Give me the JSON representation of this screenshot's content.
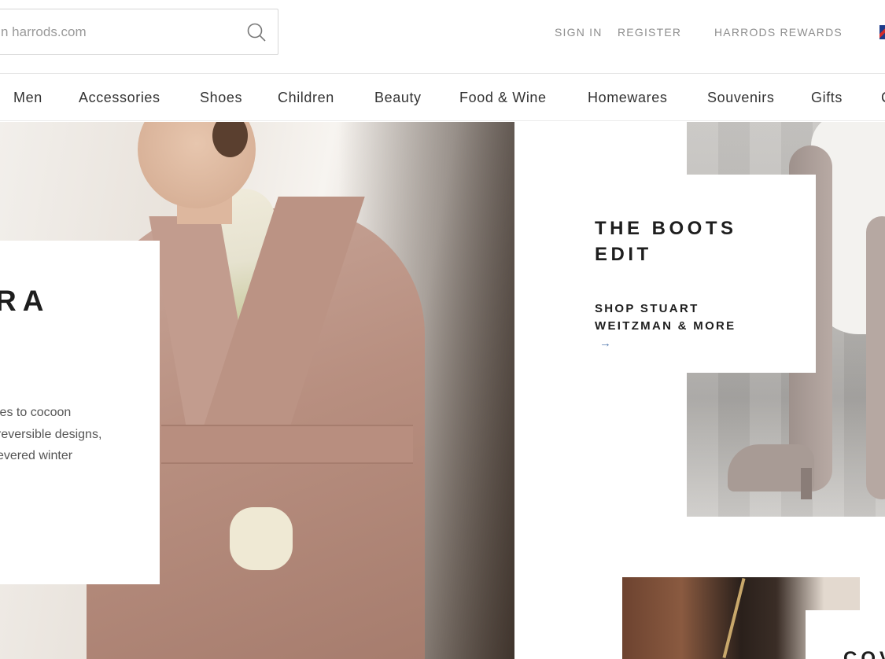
{
  "search": {
    "placeholder": "n harrods.com"
  },
  "header": {
    "sign_in": "SIGN IN",
    "register": "REGISTER",
    "rewards": "HARRODS REWARDS"
  },
  "nav": {
    "items": [
      "Men",
      "Accessories",
      "Shoes",
      "Children",
      "Beauty",
      "Food & Wine",
      "Homewares",
      "Souvenirs",
      "Gifts",
      "C"
    ]
  },
  "hero": {
    "title": "RA",
    "desc": [
      "les to cocoon",
      "reversible designs,",
      "evered winter"
    ]
  },
  "boots": {
    "title": [
      "THE BOOTS",
      "EDIT"
    ],
    "link": [
      "SHOP STUART",
      "WEITZMAN & MORE"
    ],
    "arrow": "→"
  },
  "cov": {
    "title": "COV"
  },
  "colors": {
    "link_arrow": "#5a7fb2",
    "text_dark": "#1e1e1e",
    "text_muted": "#8e8e8e"
  }
}
